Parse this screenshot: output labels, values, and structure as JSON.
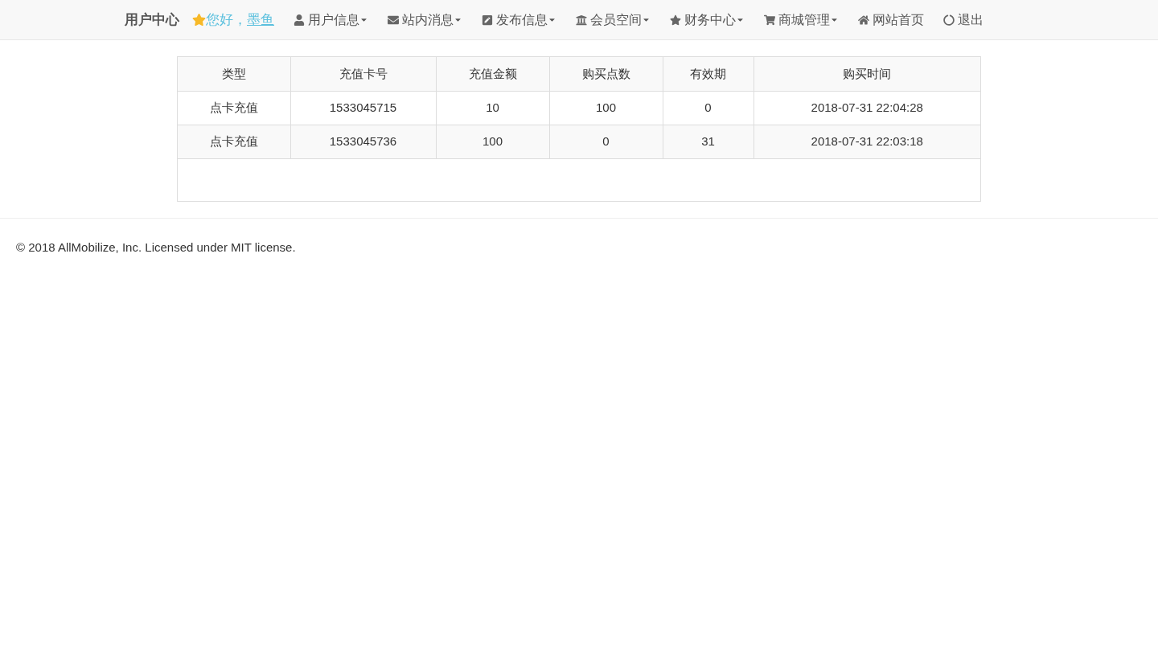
{
  "navbar": {
    "brand": "用户中心",
    "greeting": "您好，",
    "username": "墨鱼",
    "items": [
      {
        "label": "用户信息",
        "dropdown": true
      },
      {
        "label": "站内消息",
        "dropdown": true
      },
      {
        "label": "发布信息",
        "dropdown": true
      },
      {
        "label": "会员空间",
        "dropdown": true
      },
      {
        "label": "财务中心",
        "dropdown": true
      },
      {
        "label": "商城管理",
        "dropdown": true
      },
      {
        "label": "网站首页",
        "dropdown": false
      },
      {
        "label": "退出",
        "dropdown": false
      }
    ]
  },
  "table": {
    "columns": [
      "类型",
      "充值卡号",
      "充值金额",
      "购买点数",
      "有效期",
      "购买时间"
    ],
    "rows": [
      [
        "点卡充值",
        "1533045715",
        "10",
        "100",
        "0",
        "2018-07-31 22:04:28"
      ],
      [
        "点卡充值",
        "1533045736",
        "100",
        "0",
        "31",
        "2018-07-31 22:03:18"
      ]
    ]
  },
  "footer": "© 2018 AllMobilize, Inc. Licensed under MIT license."
}
